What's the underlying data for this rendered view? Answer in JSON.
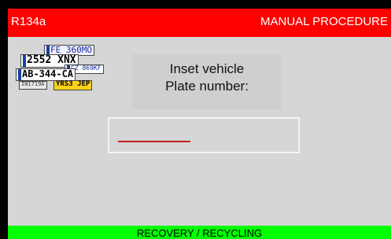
{
  "header": {
    "refrigerant": "R134a",
    "mode": "MANUAL PROCEDURE"
  },
  "plates_image": {
    "icon": "license-plates-icon",
    "plates": [
      "FE 360MO",
      "2552 XNX",
      "CZ 869KF",
      "AB-344-CA",
      "IN1719A",
      "YRS3 JEP"
    ]
  },
  "prompt": {
    "line1": "Inset vehicle",
    "line2": "Plate number:"
  },
  "plate_input": {
    "value": ""
  },
  "footer": {
    "label": "RECOVERY / RECYCLING"
  },
  "colors": {
    "header_bg": "#ff0000",
    "footer_bg": "#00ff00",
    "screen_bg": "#d6d6d6",
    "cursor": "#c02020"
  }
}
